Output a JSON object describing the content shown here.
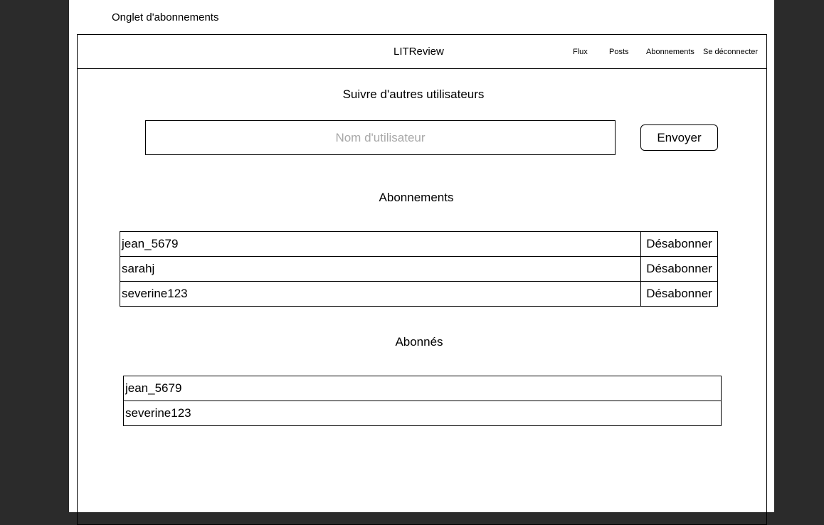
{
  "page_label": "Onglet d'abonnements",
  "navbar": {
    "brand": "LITReview",
    "links": {
      "flux": "Flux",
      "posts": "Posts",
      "abonnements": "Abonnements",
      "logout": "Se déconnecter"
    }
  },
  "follow": {
    "title": "Suivre d'autres utilisateurs",
    "input_placeholder": "Nom d'utilisateur",
    "input_value": "",
    "submit_label": "Envoyer"
  },
  "subscriptions": {
    "title": "Abonnements",
    "rows": [
      {
        "username": "jean_5679",
        "action": "Désabonner"
      },
      {
        "username": "sarahj",
        "action": "Désabonner"
      },
      {
        "username": "severine123",
        "action": "Désabonner"
      }
    ]
  },
  "followers": {
    "title": "Abonnés",
    "rows": [
      {
        "username": "jean_5679"
      },
      {
        "username": "severine123"
      }
    ]
  }
}
